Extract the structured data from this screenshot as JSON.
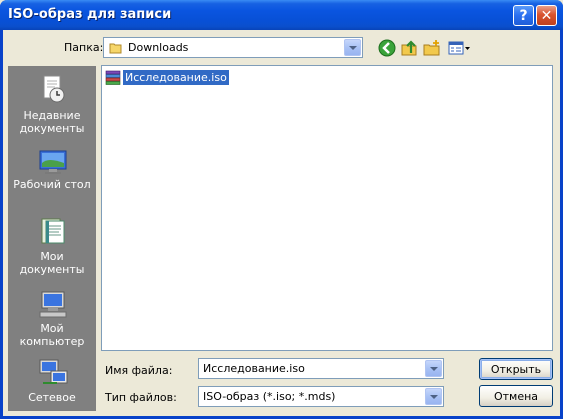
{
  "window": {
    "title": "ISO-образ для записи"
  },
  "title_buttons": {
    "help": "?",
    "close": "✕"
  },
  "toolbar": {
    "look_in_label": "Папка:",
    "look_in_value": "Downloads",
    "icons": [
      "back-icon",
      "up-folder-icon",
      "new-folder-icon",
      "view-menu-icon"
    ]
  },
  "places": [
    {
      "id": "recent",
      "label": "Недавние\nдокументы",
      "icon": "recent-documents-icon"
    },
    {
      "id": "desktop",
      "label": "Рабочий стол",
      "icon": "desktop-icon"
    },
    {
      "id": "my-documents",
      "label": "Мои документы",
      "icon": "my-documents-icon"
    },
    {
      "id": "my-computer",
      "label": "Мой\nкомпьютер",
      "icon": "my-computer-icon"
    },
    {
      "id": "network",
      "label": "Сетевое",
      "icon": "network-icon"
    }
  ],
  "files": [
    {
      "name": "Исследование.iso",
      "icon": "iso-file-icon",
      "selected": true
    }
  ],
  "filename": {
    "label": "Имя файла:",
    "value": "Исследование.iso"
  },
  "filetype": {
    "label": "Тип файлов:",
    "value": "ISO-образ (*.iso; *.mds)"
  },
  "buttons": {
    "open": "Открыть",
    "cancel": "Отмена"
  },
  "colors": {
    "title_blue": "#0a55e0",
    "selection": "#316ac5",
    "face": "#ece9d8",
    "places_bg": "#808080"
  }
}
